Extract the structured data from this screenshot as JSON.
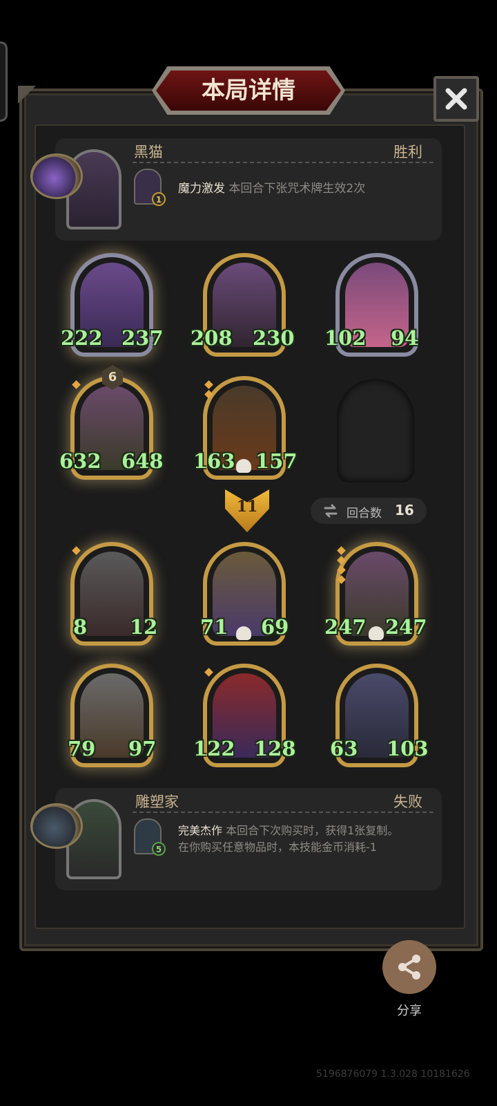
{
  "title": "本局详情",
  "top_player": {
    "name": "黑猫",
    "result": "胜利",
    "skill": {
      "level": "1",
      "name": "魔力激发",
      "desc": "本回合下张咒术牌生效2次"
    }
  },
  "top_cards": [
    {
      "attack": "222",
      "health": "237"
    },
    {
      "attack": "208",
      "health": "230"
    },
    {
      "attack": "102",
      "health": "94"
    },
    {
      "attack": "632",
      "health": "648",
      "level": "6"
    },
    {
      "attack": "163",
      "health": "157"
    }
  ],
  "arrow_value": "11",
  "rounds": {
    "label": "回合数",
    "value": "16"
  },
  "bottom_cards": [
    {
      "attack": "8",
      "health": "12"
    },
    {
      "attack": "71",
      "health": "69"
    },
    {
      "attack": "247",
      "health": "247"
    },
    {
      "attack": "79",
      "health": "97"
    },
    {
      "attack": "122",
      "health": "128"
    },
    {
      "attack": "63",
      "health": "103"
    }
  ],
  "bottom_player": {
    "name": "雕塑家",
    "result": "失败",
    "skill": {
      "level": "5",
      "name": "完美杰作",
      "desc1": "本回合下次购买时，获得1张复制。",
      "desc2": "在你购买任意物品时，本技能金币消耗-1"
    }
  },
  "share_label": "分享",
  "build_string": "5196876079 1.3.028 10181626",
  "icons": {
    "close": "close-icon",
    "share": "share-icon",
    "rounds": "rounds-icon",
    "skull": "skull-icon"
  },
  "colors": {
    "stat": "#aaf29a",
    "gold_frame": "#c49a45",
    "banner": "#6e1414"
  }
}
